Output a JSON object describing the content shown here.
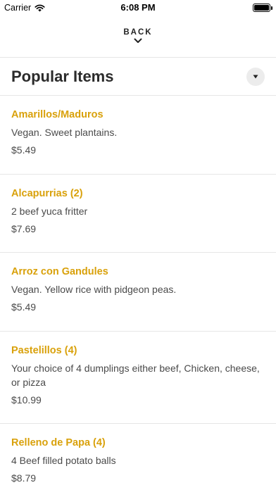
{
  "status_bar": {
    "carrier": "Carrier",
    "time": "6:08 PM",
    "battery_level": 1.0
  },
  "back": {
    "label": "BACK",
    "icon": "chevron-down-icon"
  },
  "section": {
    "title": "Popular Items",
    "toggle_icon": "caret-down-icon"
  },
  "items": [
    {
      "name": "Amarillos/Maduros",
      "description": "Vegan. Sweet plantains.",
      "price": "$5.49"
    },
    {
      "name": "Alcapurrias (2)",
      "description": "2 beef yuca fritter",
      "price": "$7.69"
    },
    {
      "name": "Arroz con Gandules",
      "description": "Vegan. Yellow rice with pidgeon peas.",
      "price": "$5.49"
    },
    {
      "name": "Pastelillos (4)",
      "description": "Your choice of 4 dumplings either beef, Chicken, cheese, or pizza",
      "price": "$10.99"
    },
    {
      "name": "Relleno de Papa (4)",
      "description": "4 Beef filled potato balls",
      "price": "$8.79"
    }
  ],
  "colors": {
    "item_name": "#d9a10b",
    "text": "#2b2b2b",
    "divider": "#e6e6e6",
    "toggle_bg": "#ececec"
  }
}
